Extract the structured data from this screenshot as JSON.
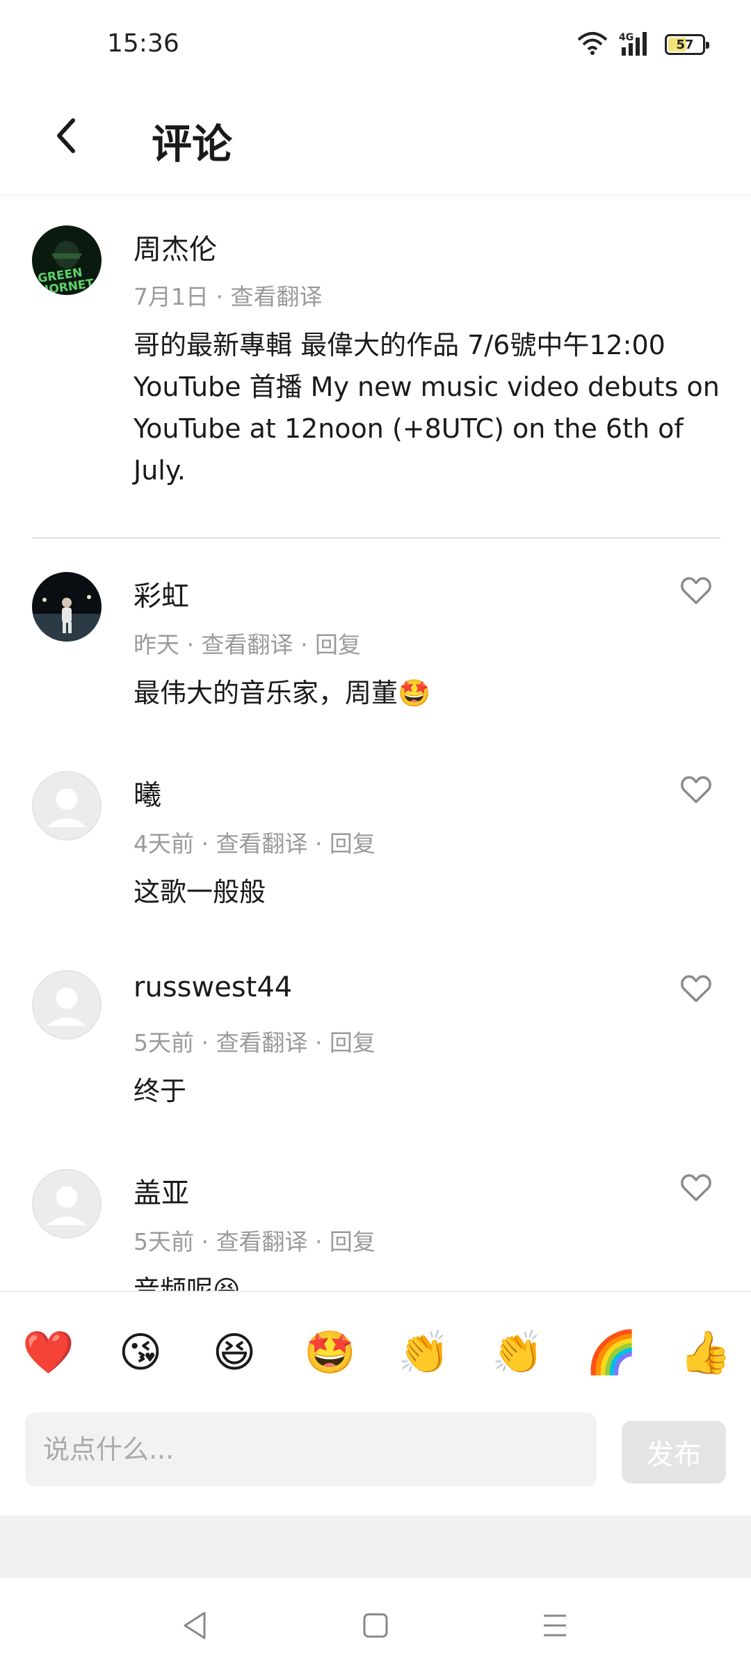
{
  "status_bar": {
    "time": "15:36",
    "network": "4G",
    "battery_percent": 57,
    "battery_label": "57",
    "icons": [
      "wifi-icon",
      "cellular-signal-icon",
      "battery-icon"
    ]
  },
  "header": {
    "title": "评论",
    "back_icon": "chevron-left-icon"
  },
  "main_post": {
    "author": "周杰伦",
    "meta": "7月1日 · 查看翻译",
    "text": "哥的最新專輯 最偉大的作品 7/6號中午12:00 YouTube 首播 My new music video debuts on YouTube at 12noon (+8UTC) on the 6th of July."
  },
  "comments": [
    {
      "author": "彩虹",
      "meta": "昨天 · 查看翻译 · 回复",
      "text": "最伟大的音乐家，周董🤩"
    },
    {
      "author": "曦",
      "meta": "4天前 · 查看翻译 · 回复",
      "text": "这歌一般般"
    },
    {
      "author": "russwest44",
      "meta": "5天前 · 查看翻译 · 回复",
      "text": "终于"
    },
    {
      "author": "盖亚",
      "meta": "5天前 · 查看翻译 · 回复",
      "text": "音频呢😆"
    }
  ],
  "emoji_bar": [
    "❤️",
    "😘",
    "😆",
    "🤩",
    "👏",
    "👏",
    "🌈",
    "👍"
  ],
  "composer": {
    "placeholder": "说点什么...",
    "post_label": "发布"
  },
  "nav": {
    "icons": [
      "back-triangle-icon",
      "home-square-icon",
      "menu-lines-icon"
    ]
  },
  "colors": {
    "text": "#1a1a1a",
    "meta": "#9a9a9a",
    "divider": "#dedede",
    "input_bg": "#f2f2f2",
    "post_button_bg": "#e4e4e4"
  }
}
